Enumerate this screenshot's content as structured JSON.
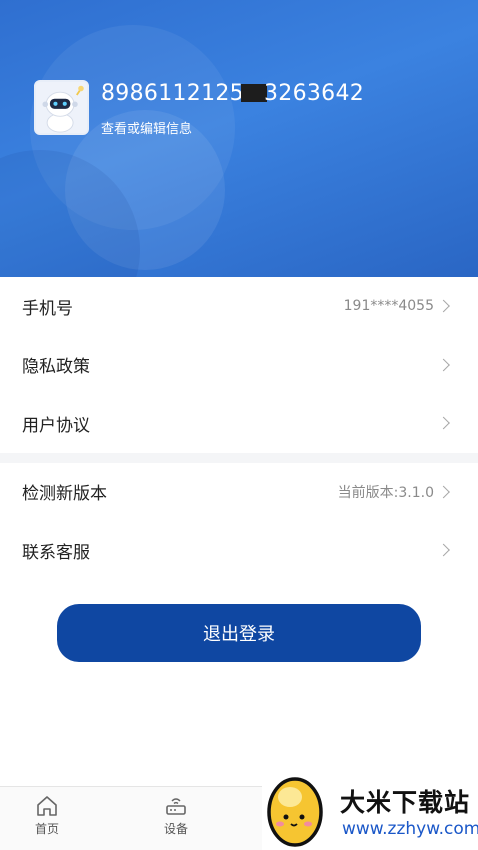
{
  "profile": {
    "user_id_prefix": "8986112125",
    "user_id_suffix": "3263642",
    "edit_label": "查看或编辑信息"
  },
  "settings": {
    "phone": {
      "label": "手机号",
      "value": "191****4055"
    },
    "privacy": {
      "label": "隐私政策"
    },
    "agreement": {
      "label": "用户协议"
    },
    "version": {
      "label": "检测新版本",
      "value": "当前版本:3.1.0"
    },
    "support": {
      "label": "联系客服"
    }
  },
  "logout_label": "退出登录",
  "tabs": {
    "home": "首页",
    "device": "设备"
  },
  "watermark": {
    "title": "大米下载站",
    "url": "www.zzhyw.com"
  },
  "colors": {
    "header": "#3b82e0",
    "logout_button": "#0f47a2",
    "watermark_url": "#1a57c8"
  },
  "icons": {
    "avatar": "robot-avatar",
    "home": "home-icon",
    "device": "router-icon",
    "chevron": "chevron-right-icon",
    "watermark": "egg-mascot-logo"
  }
}
